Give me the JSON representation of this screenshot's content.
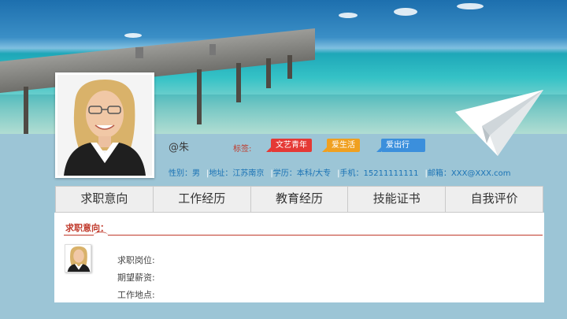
{
  "profile": {
    "handle": "@朱",
    "tags_label": "标签:",
    "tags": [
      {
        "label": "文艺青年",
        "color": "#e53935"
      },
      {
        "label": "爱生活",
        "color": "#f0a020"
      },
      {
        "label": "爱出行",
        "color": "#3b8fdc"
      }
    ],
    "info": {
      "gender": "性别：男",
      "address": "地址：江苏南京",
      "education": "学历：本科/大专",
      "phone": "手机：15211111111",
      "email": "邮箱：XXX@XXX.com"
    }
  },
  "tabs": [
    {
      "label": "求职意向"
    },
    {
      "label": "工作经历"
    },
    {
      "label": "教育经历"
    },
    {
      "label": "技能证书"
    },
    {
      "label": "自我评价"
    }
  ],
  "section": {
    "title": "求职意向：",
    "fields": [
      {
        "label": "求职岗位:"
      },
      {
        "label": "期望薪资:"
      },
      {
        "label": "工作地点:"
      }
    ]
  },
  "colors": {
    "accent_red": "#c0392b",
    "info_blue": "#1b73b5",
    "page_bg": "#9cc5d6"
  },
  "icons": {
    "plane": "paper-plane-icon"
  }
}
